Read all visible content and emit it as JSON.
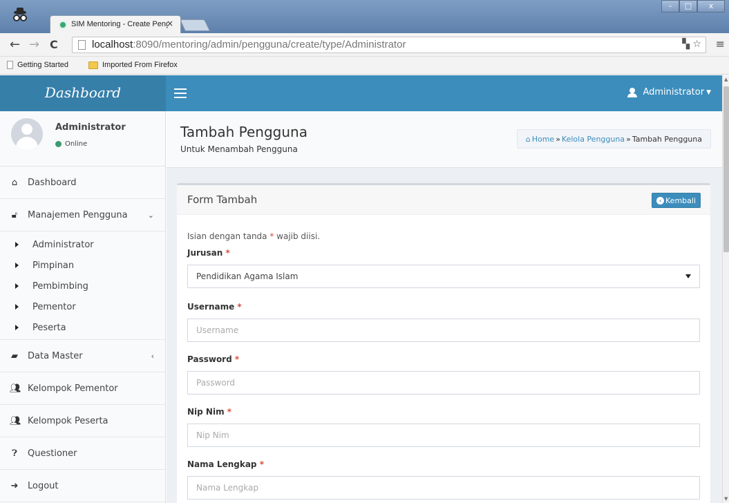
{
  "browser": {
    "tab_title": "SIM Mentoring - Create Peng",
    "tab_close": "×",
    "url_host": "localhost",
    "url_rest": ":8090/mentoring/admin/pengguna/create/type/Administrator",
    "bookmarks": [
      "Getting Started",
      "Imported From Firefox"
    ],
    "window_buttons": [
      "–",
      "□",
      "x"
    ]
  },
  "app": {
    "logo": "Dashboard",
    "navbar_user": "Administrator"
  },
  "sidebar": {
    "user_name": "Administrator",
    "user_status": "Online",
    "menu": {
      "dashboard": "Dashboard",
      "manajemen": "Manajemen Pengguna",
      "data_master": "Data Master",
      "kelompok_pementor": "Kelompok Pementor",
      "kelompok_peserta": "Kelompok Peserta",
      "questioner": "Questioner",
      "logout": "Logout"
    },
    "submenu": [
      "Administrator",
      "Pimpinan",
      "Pembimbing",
      "Pementor",
      "Peserta"
    ]
  },
  "header": {
    "title": "Tambah Pengguna",
    "subtitle": "Untuk Menambah Pengguna",
    "breadcrumb": [
      "Home",
      "Kelola Pengguna",
      "Tambah Pengguna"
    ],
    "breadcrumb_sep": "»"
  },
  "form": {
    "box_title": "Form Tambah",
    "back_button": "Kembali",
    "note_prefix": "Isian dengan tanda ",
    "note_star": "*",
    "note_suffix": " wajib diisi.",
    "required_mark": "*",
    "jurusan_label": "Jurusan",
    "jurusan_value": "Pendidikan Agama Islam",
    "username_label": "Username",
    "username_placeholder": "Username",
    "password_label": "Password",
    "password_placeholder": "Password",
    "nipnim_label": "Nip Nim",
    "nipnim_placeholder": "Nip Nim",
    "nama_label": "Nama Lengkap",
    "nama_placeholder": "Nama Lengkap"
  },
  "colors": {
    "navbar": "#3c8dbc",
    "logo_bg": "#367fa9",
    "online_dot": "#3d9970",
    "required": "#dd4b39"
  }
}
